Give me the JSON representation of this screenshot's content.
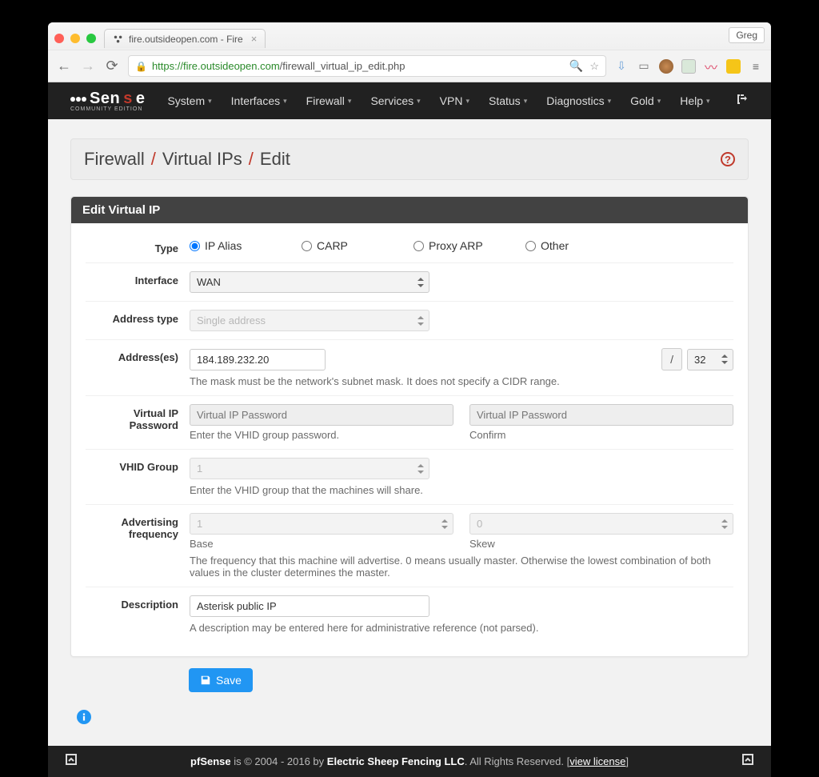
{
  "browser": {
    "tab_title": "fire.outsideopen.com - Fire",
    "profile": "Greg",
    "url_secure": "https",
    "url_host": "://fire.outsideopen.com",
    "url_path": "/firewall_virtual_ip_edit.php"
  },
  "nav": {
    "items": [
      "System",
      "Interfaces",
      "Firewall",
      "Services",
      "VPN",
      "Status",
      "Diagnostics",
      "Gold",
      "Help"
    ]
  },
  "breadcrumb": {
    "a": "Firewall",
    "b": "Virtual IPs",
    "c": "Edit"
  },
  "panel": {
    "title": "Edit Virtual IP",
    "labels": {
      "type": "Type",
      "interface": "Interface",
      "address_type": "Address type",
      "addresses": "Address(es)",
      "vip_password": "Virtual IP Password",
      "vhid_group": "VHID Group",
      "adv_freq_a": "Advertising",
      "adv_freq_b": "frequency",
      "description": "Description"
    },
    "type_options": {
      "ipalias": "IP Alias",
      "carp": "CARP",
      "proxyarp": "Proxy ARP",
      "other": "Other"
    },
    "interface_value": "WAN",
    "address_type_value": "Single address",
    "address_value": "184.189.232.20",
    "mask_slash": "/",
    "mask_value": "32",
    "addresses_help": "The mask must be the network's subnet mask. It does not specify a CIDR range.",
    "vip_pw_placeholder": "Virtual IP Password",
    "vip_pw_help": "Enter the VHID group password.",
    "vip_pw_confirm": "Confirm",
    "vhid_value": "1",
    "vhid_help": "Enter the VHID group that the machines will share.",
    "base_value": "1",
    "skew_value": "0",
    "base_label": "Base",
    "skew_label": "Skew",
    "freq_help": "The frequency that this machine will advertise. 0 means usually master. Otherwise the lowest combination of both values in the cluster determines the master.",
    "description_value": "Asterisk public IP",
    "description_help": "A description may be entered here for administrative reference (not parsed).",
    "save": "Save"
  },
  "footer": {
    "product": "pfSense",
    "mid": " is © 2004 - 2016 by ",
    "company": "Electric Sheep Fencing LLC",
    "rights": ". All Rights Reserved. [",
    "license": "view license",
    "end": "]"
  }
}
